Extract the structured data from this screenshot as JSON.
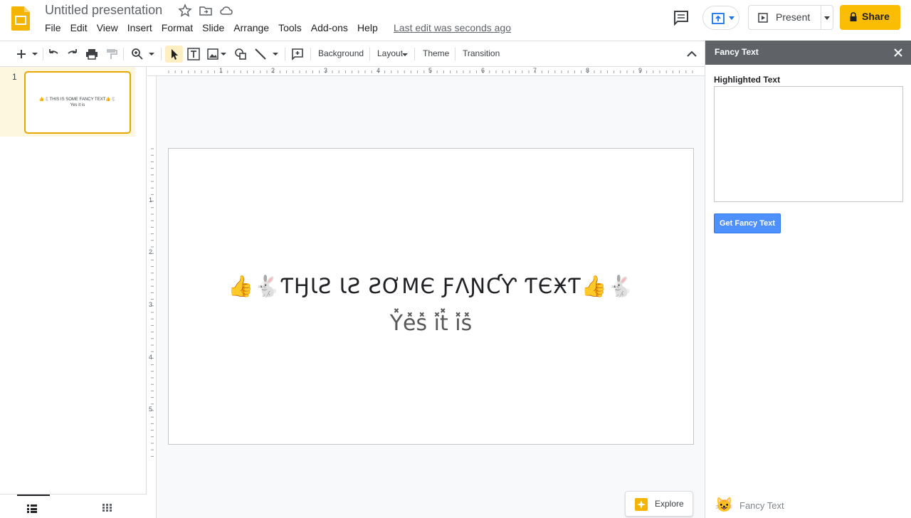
{
  "header": {
    "title": "Untitled presentation",
    "menu": [
      "File",
      "Edit",
      "View",
      "Insert",
      "Format",
      "Slide",
      "Arrange",
      "Tools",
      "Add-ons",
      "Help"
    ],
    "last_edit": "Last edit was seconds ago",
    "present_label": "Present",
    "share_label": "Share",
    "accent_color": "#fbbc04"
  },
  "toolbar": {
    "background_label": "Background",
    "layout_label": "Layout",
    "theme_label": "Theme",
    "transition_label": "Transition"
  },
  "filmstrip": {
    "slide_number": "1",
    "thumb_text_line1": "👍🐇THIS IS SOME FANCY TEXT👍🐇",
    "thumb_text_line2": "Yes it is"
  },
  "ruler": {
    "horizontal": [
      "1",
      "2",
      "3",
      "4",
      "5",
      "6",
      "7",
      "8",
      "9"
    ],
    "vertical": [
      "1",
      "2",
      "3",
      "4",
      "5"
    ]
  },
  "slide": {
    "line1": "👍🐇ƬӇƖƧ ƖƧ ƧƠMЄ ƑΛƝƇƳ ƬЄӾƬ👍🐇",
    "line2": "Y̽e̽s̽ i̽t̽ i̽s̽"
  },
  "explore": {
    "label": "Explore"
  },
  "panel": {
    "title": "Fancy Text",
    "highlight_label": "Highlighted Text",
    "highlight_value": "",
    "button_label": "Get Fancy Text",
    "footer_icon": "😺",
    "footer_label": "Fancy Text"
  }
}
